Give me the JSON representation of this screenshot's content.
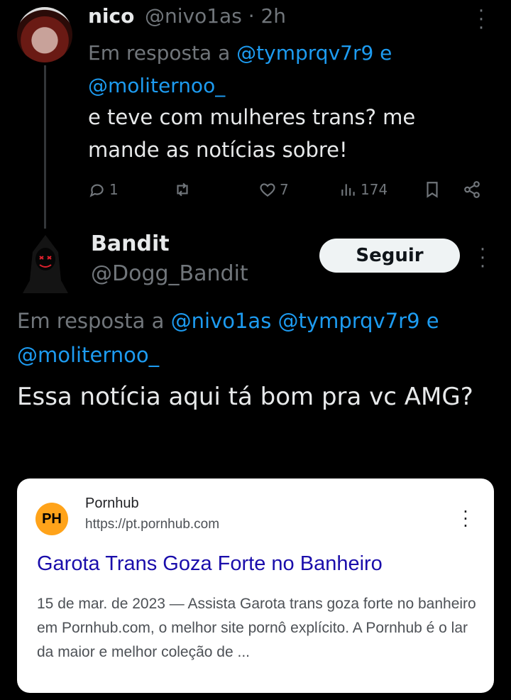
{
  "tweet1": {
    "name": "nico",
    "handle_time": "@nivo1as · 2h",
    "reply_prefix": "Em resposta a",
    "reply_mentions": "@tymprqv7r9 e @moliternoo_",
    "text": "e teve com mulheres trans? me mande as notícias sobre!",
    "actions": {
      "replies": "1",
      "retweets": "",
      "likes": "7",
      "views": "174"
    }
  },
  "tweet2": {
    "name": "Bandit",
    "handle": "@Dogg_Bandit",
    "follow_label": "Seguir",
    "reply_prefix": "Em resposta a",
    "reply_mentions": "@nivo1as @tymprqv7r9 e @moliternoo_",
    "text": "Essa notícia aqui tá bom pra vc AMG?"
  },
  "card": {
    "logo_text": "PH",
    "site_name": "Pornhub",
    "url": "https://pt.pornhub.com",
    "title": "Garota Trans Goza Forte no Banheiro",
    "snippet": "15 de mar. de 2023 — Assista Garota trans goza forte no banheiro em Pornhub.com, o melhor site pornô explícito. A Pornhub é o lar da maior e melhor coleção de ..."
  },
  "icons": {
    "reply": "reply-icon",
    "retweet": "retweet-icon",
    "like": "heart-icon",
    "views": "views-icon",
    "bookmark": "bookmark-icon",
    "share": "share-icon",
    "more": "more-vertical-icon"
  },
  "colors": {
    "background": "#000000",
    "link": "#1d9bf0",
    "muted": "#71767b",
    "card_title": "#1a0dab",
    "follow_bg": "#eff3f4"
  }
}
